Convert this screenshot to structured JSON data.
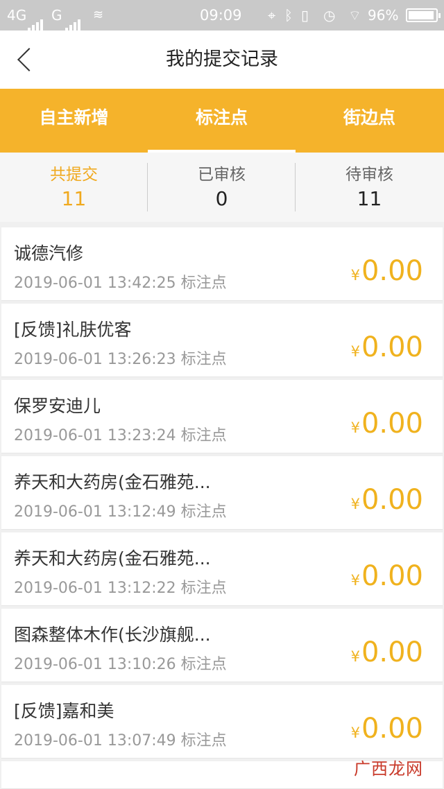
{
  "status_bar": {
    "network_1": "4G",
    "network_2": "G",
    "time": "09:09",
    "battery_percent": "96%",
    "battery_level": 0.96
  },
  "header": {
    "title": "我的提交记录",
    "back_icon": "chevron-left-icon"
  },
  "tabs": [
    {
      "label": "自主新增",
      "active": false
    },
    {
      "label": "标注点",
      "active": true
    },
    {
      "label": "街边点",
      "active": false
    }
  ],
  "summary": [
    {
      "label": "共提交",
      "value": "11"
    },
    {
      "label": "已审核",
      "value": "0"
    },
    {
      "label": "待审核",
      "value": "11"
    }
  ],
  "records": [
    {
      "name": "诚德汽修",
      "datetime": "2019-06-01 13:42:25",
      "type": "标注点",
      "currency": "¥",
      "amount": "0.00"
    },
    {
      "name": "[反馈]礼肤优客",
      "datetime": "2019-06-01 13:26:23",
      "type": "标注点",
      "currency": "¥",
      "amount": "0.00"
    },
    {
      "name": "保罗安迪儿",
      "datetime": "2019-06-01 13:23:24",
      "type": "标注点",
      "currency": "¥",
      "amount": "0.00"
    },
    {
      "name": "养天和大药房(金石雅苑...",
      "datetime": "2019-06-01 13:12:49",
      "type": "标注点",
      "currency": "¥",
      "amount": "0.00"
    },
    {
      "name": "养天和大药房(金石雅苑...",
      "datetime": "2019-06-01 13:12:22",
      "type": "标注点",
      "currency": "¥",
      "amount": "0.00"
    },
    {
      "name": "图森整体木作(长沙旗舰...",
      "datetime": "2019-06-01 13:10:26",
      "type": "标注点",
      "currency": "¥",
      "amount": "0.00"
    },
    {
      "name": "[反馈]嘉和美",
      "datetime": "2019-06-01 13:07:49",
      "type": "标注点",
      "currency": "¥",
      "amount": "0.00"
    }
  ],
  "colors": {
    "accent": "#f5b32b",
    "amount": "#f0b21e",
    "active_summary": "#f0a91e"
  },
  "watermark": "广西龙网"
}
